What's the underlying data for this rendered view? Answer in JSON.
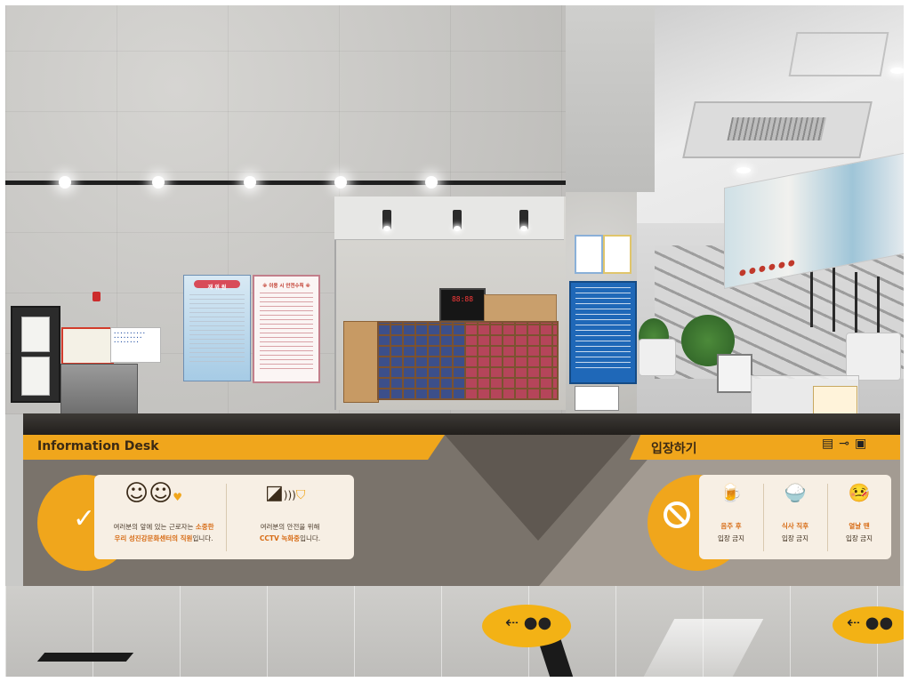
{
  "desk": {
    "title": "Information Desk",
    "entry_title": "입장하기",
    "staff_notice": {
      "line1_prefix": "여러분의 앞에 있는 근로자는 ",
      "line1_highlight": "소중한",
      "line2_highlight": "우리 성진강문화센터의 직원",
      "line2_suffix": "입니다."
    },
    "cctv_notice": {
      "line1": "여러분의 안전을 위해",
      "line2_highlight": "CCTV 녹화중",
      "line2_suffix": "입니다."
    },
    "prohibitions": [
      {
        "icon": "beer-icon",
        "glyph": "🍺",
        "label": "음주 후",
        "sub": "입장 금지"
      },
      {
        "icon": "meal-bowl-icon",
        "glyph": "🍚",
        "label": "식사 직후",
        "sub": "입장 금지"
      },
      {
        "icon": "sick-person-icon",
        "glyph": "🤒",
        "label": "열날 땐",
        "sub": "입장 금지"
      }
    ],
    "header_icons": [
      "towel-icon",
      "key-icon",
      "id-card-icon"
    ],
    "header_icon_glyphs": [
      "▤",
      "⊸",
      "▣"
    ]
  },
  "background": {
    "led_display": "88:88",
    "wall_board_label": "재 위 원",
    "wall_poster_label": "※ 이용 시 안전수칙 ※"
  },
  "colors": {
    "accent": "#f0a61c",
    "counter": "#7a736b",
    "highlight_text": "#d76b14"
  }
}
